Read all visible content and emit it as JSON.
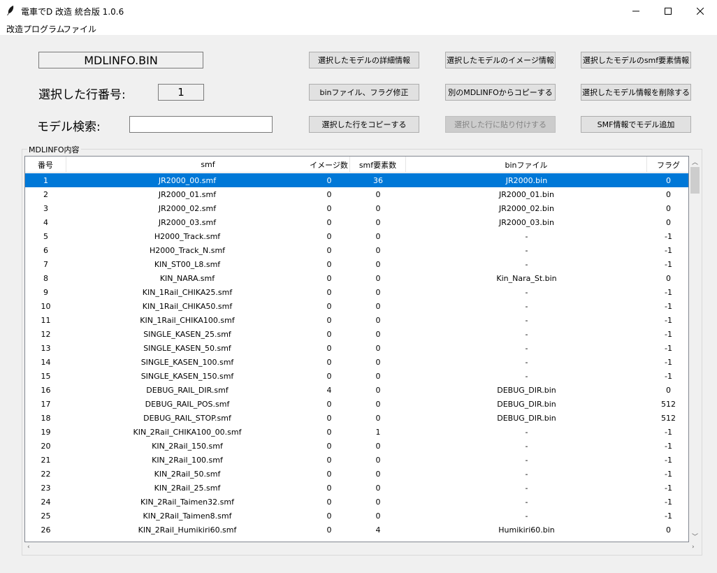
{
  "window": {
    "title": "電車でD 改造 統合版 1.0.6",
    "icon": "feather-icon"
  },
  "menu": [
    "改造プログラム",
    "ファイル"
  ],
  "file_name": "MDLINFO.BIN",
  "selected_row": {
    "label": "選択した行番号:",
    "value": "1"
  },
  "search": {
    "label": "モデル検索:",
    "value": ""
  },
  "buttons": {
    "detail": "選択したモデルの詳細情報",
    "image": "選択したモデルのイメージ情報",
    "smf_elements": "選択したモデルのsmf要素情報",
    "bin_fix": "binファイル、フラグ修正",
    "copy_other": "別のMDLINFOからコピーする",
    "delete": "選択したモデル情報を削除する",
    "copy_row": "選択した行をコピーする",
    "paste_row": "選択した行に貼り付けする",
    "add_model": "SMF情報でモデル追加"
  },
  "group_label": "MDLINFO内容",
  "table": {
    "headers": [
      "番号",
      "smf",
      "イメージ数",
      "smf要素数",
      "binファイル",
      "フラグ"
    ],
    "selected_index": 0,
    "rows": [
      [
        "1",
        "JR2000_00.smf",
        "0",
        "36",
        "JR2000.bin",
        "0"
      ],
      [
        "2",
        "JR2000_01.smf",
        "0",
        "0",
        "JR2000_01.bin",
        "0"
      ],
      [
        "3",
        "JR2000_02.smf",
        "0",
        "0",
        "JR2000_02.bin",
        "0"
      ],
      [
        "4",
        "JR2000_03.smf",
        "0",
        "0",
        "JR2000_03.bin",
        "0"
      ],
      [
        "5",
        "H2000_Track.smf",
        "0",
        "0",
        "-",
        "-1"
      ],
      [
        "6",
        "H2000_Track_N.smf",
        "0",
        "0",
        "-",
        "-1"
      ],
      [
        "7",
        "KIN_ST00_L8.smf",
        "0",
        "0",
        "-",
        "-1"
      ],
      [
        "8",
        "KIN_NARA.smf",
        "0",
        "0",
        "Kin_Nara_St.bin",
        "0"
      ],
      [
        "9",
        "KIN_1Rail_CHIKA25.smf",
        "0",
        "0",
        "-",
        "-1"
      ],
      [
        "10",
        "KIN_1Rail_CHIKA50.smf",
        "0",
        "0",
        "-",
        "-1"
      ],
      [
        "11",
        "KIN_1Rail_CHIKA100.smf",
        "0",
        "0",
        "-",
        "-1"
      ],
      [
        "12",
        "SINGLE_KASEN_25.smf",
        "0",
        "0",
        "-",
        "-1"
      ],
      [
        "13",
        "SINGLE_KASEN_50.smf",
        "0",
        "0",
        "-",
        "-1"
      ],
      [
        "14",
        "SINGLE_KASEN_100.smf",
        "0",
        "0",
        "-",
        "-1"
      ],
      [
        "15",
        "SINGLE_KASEN_150.smf",
        "0",
        "0",
        "-",
        "-1"
      ],
      [
        "16",
        "DEBUG_RAIL_DIR.smf",
        "4",
        "0",
        "DEBUG_DIR.bin",
        "0"
      ],
      [
        "17",
        "DEBUG_RAIL_POS.smf",
        "0",
        "0",
        "DEBUG_DIR.bin",
        "512"
      ],
      [
        "18",
        "DEBUG_RAIL_STOP.smf",
        "0",
        "0",
        "DEBUG_DIR.bin",
        "512"
      ],
      [
        "19",
        "KIN_2Rail_CHIKA100_00.smf",
        "0",
        "1",
        "-",
        "-1"
      ],
      [
        "20",
        "KIN_2Rail_150.smf",
        "0",
        "0",
        "-",
        "-1"
      ],
      [
        "21",
        "KIN_2Rail_100.smf",
        "0",
        "0",
        "-",
        "-1"
      ],
      [
        "22",
        "KIN_2Rail_50.smf",
        "0",
        "0",
        "-",
        "-1"
      ],
      [
        "23",
        "KIN_2Rail_25.smf",
        "0",
        "0",
        "-",
        "-1"
      ],
      [
        "24",
        "KIN_2Rail_Taimen32.smf",
        "0",
        "0",
        "-",
        "-1"
      ],
      [
        "25",
        "KIN_2Rail_Taimen8.smf",
        "0",
        "0",
        "-",
        "-1"
      ],
      [
        "26",
        "KIN_2Rail_Humikiri60.smf",
        "0",
        "4",
        "Humikiri60.bin",
        "0"
      ]
    ]
  },
  "colors": {
    "selection": "#0078d7",
    "window_bg": "#f0f0f0",
    "button_bg": "#e1e1e1",
    "button_disabled_bg": "#cccccc"
  }
}
